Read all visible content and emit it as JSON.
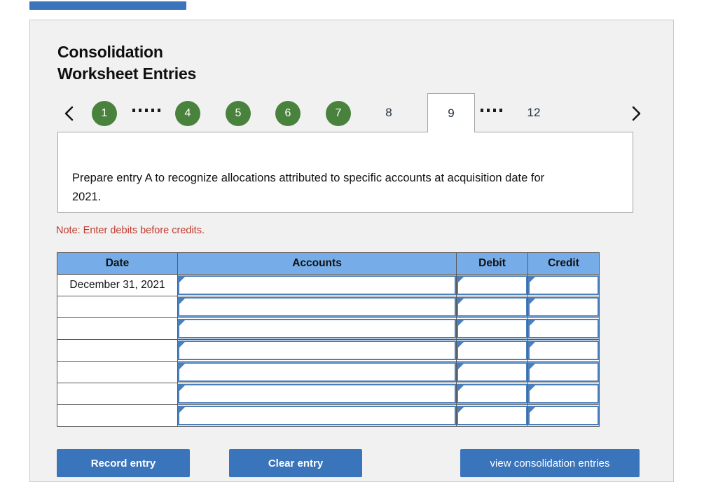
{
  "accent_colors": {
    "top_bar": "#3a74bb",
    "step_complete": "#49823c",
    "table_header": "#76ace8",
    "button": "#3a74bb",
    "note": "#c0392b",
    "input_border": "#4a7fbd"
  },
  "header": {
    "title": "Consolidation\nWorksheet Entries"
  },
  "step_nav": {
    "prev_icon": "chevron-left-icon",
    "next_icon": "chevron-right-icon",
    "steps": [
      {
        "label": "1",
        "state": "done"
      },
      {
        "label": "",
        "state": "dots",
        "dot_count": 5
      },
      {
        "label": "4",
        "state": "done"
      },
      {
        "label": "5",
        "state": "done"
      },
      {
        "label": "6",
        "state": "done"
      },
      {
        "label": "7",
        "state": "done"
      },
      {
        "label": "8",
        "state": "plain"
      },
      {
        "label": "9",
        "state": "active"
      },
      {
        "label": "",
        "state": "dots",
        "dot_count": 4
      },
      {
        "label": "12",
        "state": "plain"
      }
    ]
  },
  "instruction": {
    "text": "Prepare entry A to recognize allocations attributed to specific accounts at acquisition date for 2021."
  },
  "note": {
    "text": "Note: Enter debits before credits."
  },
  "table": {
    "columns": [
      "Date",
      "Accounts",
      "Debit",
      "Credit"
    ],
    "rows": [
      {
        "date": "December 31, 2021",
        "accounts": "",
        "debit": "",
        "credit": ""
      },
      {
        "date": "",
        "accounts": "",
        "debit": "",
        "credit": ""
      },
      {
        "date": "",
        "accounts": "",
        "debit": "",
        "credit": ""
      },
      {
        "date": "",
        "accounts": "",
        "debit": "",
        "credit": ""
      },
      {
        "date": "",
        "accounts": "",
        "debit": "",
        "credit": ""
      },
      {
        "date": "",
        "accounts": "",
        "debit": "",
        "credit": ""
      },
      {
        "date": "",
        "accounts": "",
        "debit": "",
        "credit": ""
      }
    ]
  },
  "buttons": {
    "record": "Record entry",
    "clear": "Clear entry",
    "view": "view consolidation entries"
  }
}
